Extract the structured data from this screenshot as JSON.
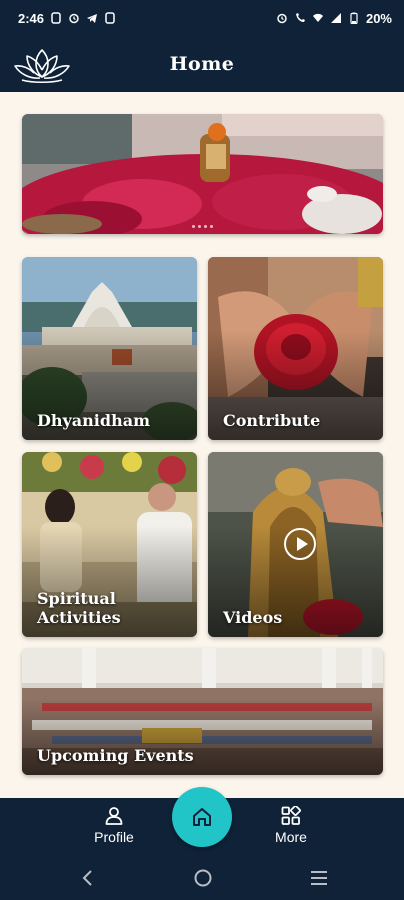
{
  "status_bar": {
    "time": "2:46",
    "battery": "20%",
    "left_icons": [
      "sim-icon",
      "alarm-icon",
      "telegram-icon",
      "sim-icon"
    ],
    "right_icons": [
      "alarm-icon",
      "wifi-calling-icon",
      "wifi-icon",
      "signal-icon",
      "battery-icon"
    ]
  },
  "header": {
    "title": "Home",
    "logo": "lotus-logo-icon"
  },
  "banner": {
    "image": "flowers-and-shrine-photo",
    "dots": 4
  },
  "tiles": [
    {
      "label": "Dhyanidham",
      "image": "ashram-building-photo"
    },
    {
      "label": "Contribute",
      "image": "hands-holding-rose-photo"
    },
    {
      "label": "Spiritual\nActivities",
      "image": "people-meditating-photo"
    },
    {
      "label": "Videos",
      "image": "idol-with-play-button-photo"
    },
    {
      "label": "Upcoming Events",
      "image": "crowded-hall-photo"
    }
  ],
  "bottom_nav": {
    "profile_label": "Profile",
    "more_label": "More",
    "home_icon": "home-icon"
  },
  "colors": {
    "navy": "#0f2238",
    "teal": "#21c4c7",
    "cream": "#fbf5ec"
  }
}
